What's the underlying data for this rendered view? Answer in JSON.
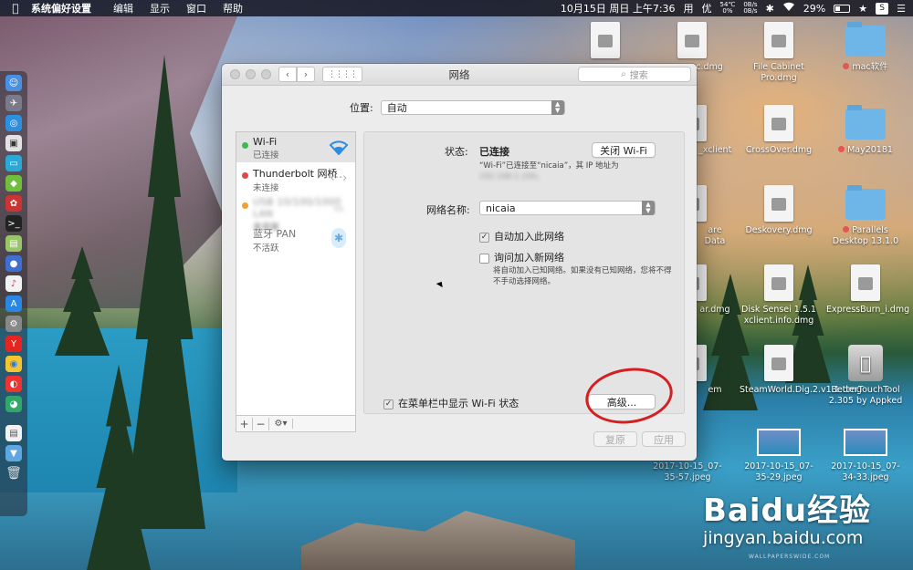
{
  "menubar": {
    "apple": "",
    "app_name": "系统偏好设置",
    "items": [
      "编辑",
      "显示",
      "窗口",
      "帮助"
    ],
    "datetime": "10月15日 周日 上午7:36",
    "input_method": "用",
    "user": "优",
    "temp": "54℃",
    "temp_sub": "0%",
    "net_up": "0B/s",
    "net_down": "0B/s",
    "battery": "29%"
  },
  "window": {
    "title": "网络",
    "search_placeholder": "搜索",
    "location_label": "位置:",
    "location_value": "自动",
    "services": [
      {
        "name": "Wi-Fi",
        "status": "已连接",
        "dot": "#3fb950"
      },
      {
        "name": "Thunderbolt 网桥",
        "status": "未连接",
        "dot": "#e04848"
      },
      {
        "name": "USB 10/100/1000 LAN",
        "status": "未连接",
        "dot": "#f0a030"
      },
      {
        "name": "蓝牙 PAN",
        "status": "不活跃",
        "dot": ""
      }
    ],
    "tools": {
      "add": "+",
      "remove": "−",
      "gear": "⚙︎▾"
    },
    "status_label": "状态:",
    "status_value": "已连接",
    "turn_off_button": "关闭 Wi-Fi",
    "status_detail": "“Wi-Fi”已连接至“nicaia”，其 IP 地址为",
    "status_detail_ip": "192.168.1.100。",
    "network_name_label": "网络名称:",
    "network_name_value": "nicaia",
    "auto_join_label": "自动加入此网络",
    "ask_join_label": "询问加入新网络",
    "ask_join_note": "将自动加入已知网络。如果没有已知网络，您将不得不手动选择网络。",
    "show_menu_label": "在菜单栏中显示 Wi-Fi 状态",
    "advanced_button": "高级...",
    "help_button": "?",
    "revert_button": "复原",
    "apply_button": "应用"
  },
  "desktop": {
    "icons": [
      {
        "label": ""
      },
      {
        "label": "c.dmg"
      },
      {
        "label": "File Cabinet Pro.dmg"
      },
      {
        "label": "mac软件"
      },
      {
        "label": "_xclient"
      },
      {
        "label": "CrossOver.dmg"
      },
      {
        "label": "May20181"
      },
      {
        "label": "are Data"
      },
      {
        "label": "Deskovery.dmg"
      },
      {
        "label": "Parallels Desktop 13.1.0"
      },
      {
        "label": "ar.dmg"
      },
      {
        "label": "Disk Sensei 1.5.1 xclient.info.dmg"
      },
      {
        "label": "ExpressBurn_i.dmg"
      },
      {
        "label": "em"
      },
      {
        "label": "SteamWorld.Dig.2.v1.1.dmg"
      },
      {
        "label": "BetterTouchTool 2.305 by Appked"
      },
      {
        "label": "2017-10-15_07-35-57.jpeg"
      },
      {
        "label": "2017-10-15_07-35-29.jpeg"
      },
      {
        "label": "2017-10-15_07-34-33.jpeg"
      }
    ]
  },
  "watermark": {
    "brand": "Baidu经验",
    "url": "jingyan.baidu.com",
    "credit": "WALLPAPERSWIDE.COM"
  }
}
